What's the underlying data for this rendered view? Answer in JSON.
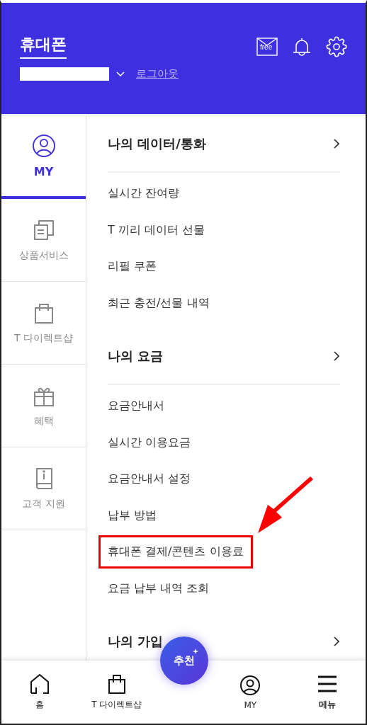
{
  "header": {
    "title": "휴대폰",
    "logout": "로그아웃",
    "mail_badge": "free"
  },
  "sidebar": {
    "items": [
      {
        "label": "MY",
        "kind": "user",
        "selected": true
      },
      {
        "label": "상품서비스",
        "kind": "docs",
        "selected": false
      },
      {
        "label": "T 다이렉트샵",
        "kind": "bag",
        "selected": false
      },
      {
        "label": "혜택",
        "kind": "gift",
        "selected": false
      },
      {
        "label": "고객 지원",
        "kind": "book",
        "selected": false
      }
    ]
  },
  "sections": [
    {
      "title": "나의 데이터/통화",
      "items": [
        {
          "label": "실시간 잔여량",
          "highlighted": false
        },
        {
          "label": "T 끼리 데이터 선물",
          "highlighted": false
        },
        {
          "label": "리필 쿠폰",
          "highlighted": false
        },
        {
          "label": "최근 충전/선물 내역",
          "highlighted": false
        }
      ]
    },
    {
      "title": "나의 요금",
      "items": [
        {
          "label": "요금안내서",
          "highlighted": false
        },
        {
          "label": "실시간 이용요금",
          "highlighted": false
        },
        {
          "label": "요금안내서 설정",
          "highlighted": false
        },
        {
          "label": "납부 방법",
          "highlighted": false
        },
        {
          "label": "휴대폰 결제/콘텐츠 이용료",
          "highlighted": true
        },
        {
          "label": "요금 납부 내역 조회",
          "highlighted": false
        }
      ]
    },
    {
      "title": "나의 가입"
    }
  ],
  "fab": {
    "label": "추천"
  },
  "bottom_nav": [
    {
      "label": "홈",
      "kind": "home",
      "bold": false
    },
    {
      "label": "T 다이렉트샵",
      "kind": "bag",
      "bold": false
    },
    {
      "label": "MY",
      "kind": "user",
      "bold": false
    },
    {
      "label": "메뉴",
      "kind": "menu",
      "bold": true
    }
  ]
}
